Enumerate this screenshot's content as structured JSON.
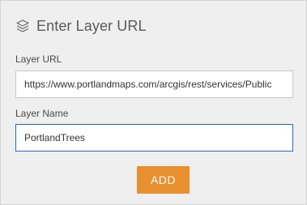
{
  "header": {
    "icon": "layers-icon",
    "title": "Enter Layer URL"
  },
  "form": {
    "url_label": "Layer URL",
    "url_value": "https://www.portlandmaps.com/arcgis/rest/services/Public",
    "name_label": "Layer Name",
    "name_value": "PortlandTrees"
  },
  "actions": {
    "add_label": "ADD"
  },
  "colors": {
    "panel_background": "#efefef",
    "accent_button": "#e8902f",
    "focus_border": "#2d6aa7"
  }
}
